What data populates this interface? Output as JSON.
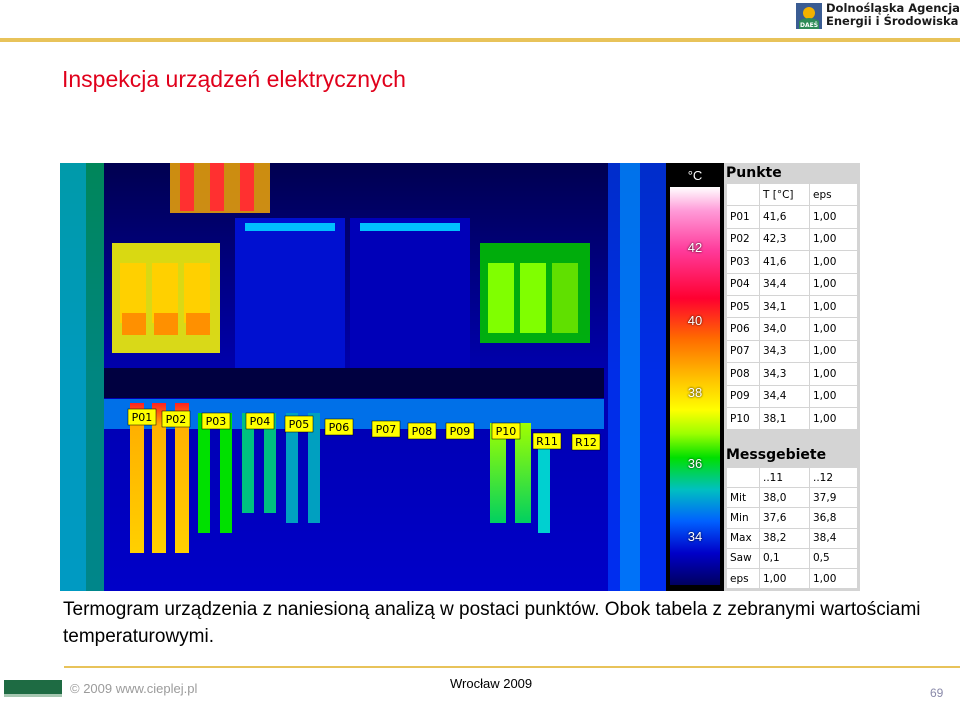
{
  "header": {
    "logo_badge": "DAEŚ",
    "logo_line1": "Dolnośląska Agencja",
    "logo_line2": "Energii i Środowiska"
  },
  "slide": {
    "title": "Inspekcja urządzeń elektrycznych",
    "caption": "Termogram urządzenia z naniesioną analizą w postaci punktów. Obok tabela z zebranymi wartościami temperaturowymi."
  },
  "thermogram": {
    "point_labels": [
      "P01",
      "P02",
      "P03",
      "P04",
      "P05",
      "P06",
      "P07",
      "P08",
      "P09",
      "P10",
      "R11",
      "R12"
    ]
  },
  "scale": {
    "unit": "°C",
    "ticks": [
      "42",
      "40",
      "38",
      "36",
      "34"
    ]
  },
  "punkte": {
    "title": "Punkte",
    "headers": [
      "",
      "T [°C]",
      "eps"
    ],
    "rows": [
      [
        "P01",
        "41,6",
        "1,00"
      ],
      [
        "P02",
        "42,3",
        "1,00"
      ],
      [
        "P03",
        "41,6",
        "1,00"
      ],
      [
        "P04",
        "34,4",
        "1,00"
      ],
      [
        "P05",
        "34,1",
        "1,00"
      ],
      [
        "P06",
        "34,0",
        "1,00"
      ],
      [
        "P07",
        "34,3",
        "1,00"
      ],
      [
        "P08",
        "34,3",
        "1,00"
      ],
      [
        "P09",
        "34,4",
        "1,00"
      ],
      [
        "P10",
        "38,1",
        "1,00"
      ]
    ]
  },
  "messgebiete": {
    "title": "Messgebiete",
    "headers": [
      "",
      "..11",
      "..12"
    ],
    "rows": [
      [
        "Mit",
        "38,0",
        "37,9"
      ],
      [
        "Min",
        "37,6",
        "36,8"
      ],
      [
        "Max",
        "38,2",
        "38,4"
      ],
      [
        "Saw",
        "0,1",
        "0,5"
      ],
      [
        "eps",
        "1,00",
        "1,00"
      ]
    ]
  },
  "footer": {
    "copyright": "© 2009 www.cieplej.pl",
    "center": "Wrocław 2009",
    "page_number": "69"
  }
}
